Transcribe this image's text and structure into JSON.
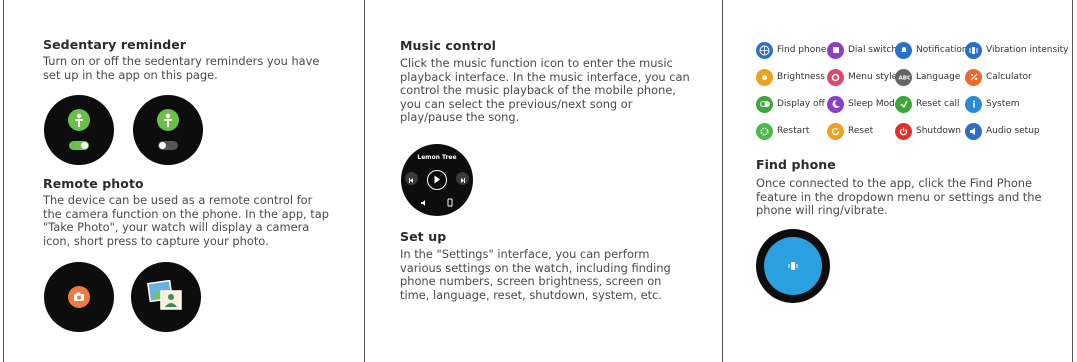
{
  "sedentary": {
    "title": "Sedentary reminder",
    "text": "Turn on or off the sedentary reminders you have set up in the app on this page."
  },
  "remote_photo": {
    "title": "Remote photo",
    "text": "The device can be used as a remote control for the camera function on the phone. In the app, tap \"Take Photo\", your watch will display a camera icon, short press to capture your photo."
  },
  "music": {
    "title": "Music control",
    "text": "Click the music function icon to enter the music playback interface. In the music interface, you can control the music playback of the mobile phone, you can select the previous/next song or play/pause the song.",
    "song_title": "Lemon Tree"
  },
  "setup": {
    "title": "Set up",
    "text": "In the \"Settings\" interface, you can perform various settings on the watch, including finding phone numbers, screen brightness, screen on time, language, reset, shutdown, system, etc."
  },
  "functions": [
    {
      "label": "Find phone",
      "icon": "globe-icon",
      "color": "#2a6fc9"
    },
    {
      "label": "Dial switch",
      "icon": "dial-icon",
      "color": "#8a3fc8"
    },
    {
      "label": "Notification",
      "icon": "bell-icon",
      "color": "#2a6fc9"
    },
    {
      "label": "Vibration intensity",
      "icon": "vibration-icon",
      "color": "#2a6fc9"
    },
    {
      "label": "Brightness",
      "icon": "sun-icon",
      "color": "#f0a020"
    },
    {
      "label": "Menu style",
      "icon": "flower-icon",
      "color": "#e04a6a"
    },
    {
      "label": "Language",
      "icon": "abc-icon",
      "color": "#666666"
    },
    {
      "label": "Calculator",
      "icon": "percent-icon",
      "color": "#ef6a2a"
    },
    {
      "label": "Display off",
      "icon": "toggle-icon",
      "color": "#3aa83a"
    },
    {
      "label": "Sleep Mode",
      "icon": "moon-icon",
      "color": "#8a3fc8"
    },
    {
      "label": "Reset call",
      "icon": "reset-call-icon",
      "color": "#3aa83a"
    },
    {
      "label": "System",
      "icon": "info-icon",
      "color": "#2a8ad8"
    },
    {
      "label": "Restart",
      "icon": "gear-icon",
      "color": "#4cb84a"
    },
    {
      "label": "Reset",
      "icon": "reset-icon",
      "color": "#f0a020"
    },
    {
      "label": "Shutdown",
      "icon": "power-icon",
      "color": "#e03030"
    },
    {
      "label": "Audio setup",
      "icon": "speaker-icon",
      "color": "#2a6fc9"
    }
  ],
  "find_phone": {
    "title": "Find phone",
    "text": "Once connected to the app, click the Find Phone feature in the dropdown menu or settings and the phone will ring/vibrate."
  },
  "colors": {
    "sedentary_green": "#6cc04a",
    "find_phone_blue": "#2aa0e0",
    "photo_orange": "#f07a40"
  }
}
